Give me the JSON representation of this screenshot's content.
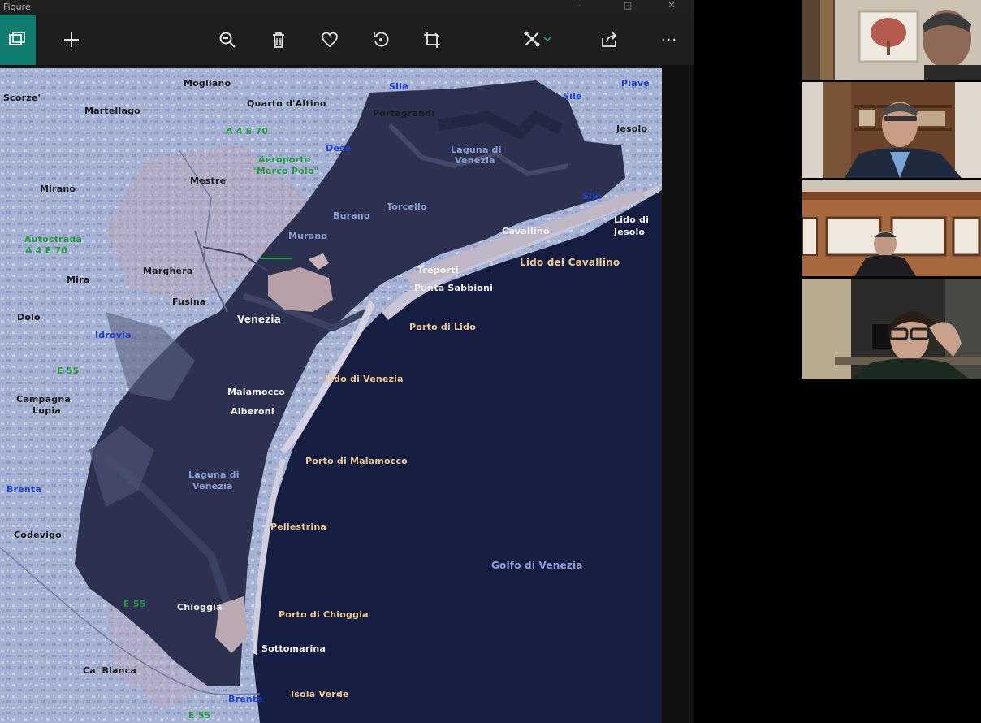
{
  "window": {
    "title": "Figure"
  },
  "toolbar": {
    "buttons": [
      {
        "name": "gallery",
        "icon": "gallery-icon"
      },
      {
        "name": "add",
        "icon": "plus-icon"
      },
      {
        "name": "zoom",
        "icon": "zoom-icon"
      },
      {
        "name": "delete",
        "icon": "trash-icon"
      },
      {
        "name": "favorite",
        "icon": "heart-icon"
      },
      {
        "name": "rotate",
        "icon": "rotate-icon"
      },
      {
        "name": "crop",
        "icon": "crop-icon"
      },
      {
        "name": "edit",
        "icon": "edit-icon"
      },
      {
        "name": "share",
        "icon": "share-icon"
      },
      {
        "name": "more",
        "icon": "more-icon"
      }
    ],
    "more_label": "···"
  },
  "map": {
    "labels": {
      "mogliano": "Mogliano",
      "scorze": "Scorze'",
      "martellago": "Martellago",
      "quarto": "Quarto d'Altino",
      "sile1": "Sile",
      "piave": "Piave",
      "sile2": "Sile",
      "portegrandi": "Portegrandi",
      "jesolo": "Jesolo",
      "a4e70": "A 4 E 70",
      "dese": "Dese",
      "aeroporto1": "Aeroporto",
      "aeroporto2": "\"Marco Polo\"",
      "laguna_ven1": "Laguna di",
      "laguna_ven2": "Venezia",
      "mestre": "Mestre",
      "mirano": "Mirano",
      "burano": "Burano",
      "torcello": "Torcello",
      "sile3": "Sile",
      "lido_jesolo1": "Lido di",
      "lido_jesolo2": "Jesolo",
      "autostrada1": "Autostrada",
      "autostrada2": "A 4 E 70",
      "murano": "Murano",
      "cavallino": "Cavallino",
      "lido_cavallino": "Lido del Cavallino",
      "marghera": "Marghera",
      "treporti": "Treporti",
      "mira": "Mira",
      "punta_sabbioni": "Punta Sabbioni",
      "fusina": "Fusina",
      "venezia": "Venezia",
      "dolo": "Dolo",
      "porto_lido": "Porto di Lido",
      "idrovia": "Idrovia",
      "lido_venezia": "Lido di Venezia",
      "e55a": "E 55",
      "malamocco": "Malamocco",
      "campagna1": "Campagna",
      "campagna2": "Lupia",
      "alberoni": "Alberoni",
      "porto_malamocco": "Porto di Malamocco",
      "laguna_sud1": "Laguna di",
      "laguna_sud2": "Venezia",
      "brenta1": "Brenta",
      "pellestrina": "Pellestrina",
      "codevigo": "Codevigo",
      "golfo": "Golfo di Venezia",
      "e55b": "E 55",
      "chioggia": "Chioggia",
      "porto_chioggia": "Porto di Chioggia",
      "sottomarina": "Sottomarina",
      "ca_bianca": "Ca' Bianca",
      "brenta2": "Brenta",
      "isola_verde": "Isola Verde",
      "e55c": "E 55"
    }
  },
  "colors": {
    "accent": "#0e7c6f",
    "sea": "#141c3e",
    "lagoon": "#2f3450",
    "land": "#a6b2d3"
  },
  "participants": [
    {
      "name": "participant-1"
    },
    {
      "name": "participant-2"
    },
    {
      "name": "participant-3"
    },
    {
      "name": "participant-4"
    }
  ]
}
